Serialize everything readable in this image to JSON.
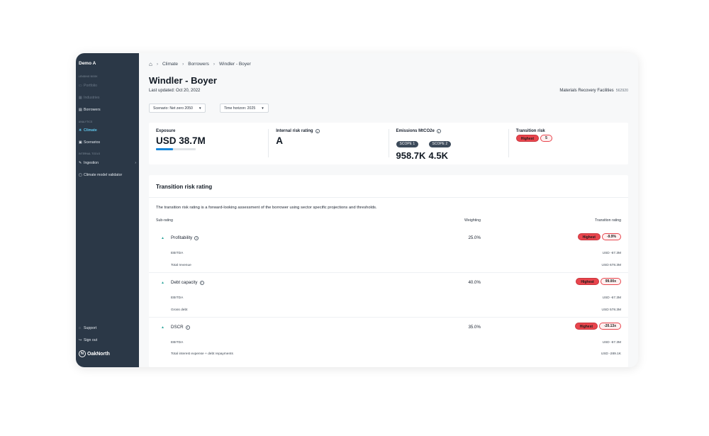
{
  "sidebar": {
    "org": "Demo A",
    "sections": {
      "lending": "LENDING BOOK",
      "analytics": "ANALYTICS",
      "internal": "INTERNAL TOOLS"
    },
    "items": [
      {
        "label": "Portfolio",
        "icon": "portfolio-icon"
      },
      {
        "label": "Industries",
        "icon": "industries-icon"
      },
      {
        "label": "Borrowers",
        "icon": "borrowers-icon"
      },
      {
        "label": "Climate",
        "icon": "climate-icon"
      },
      {
        "label": "Scenarios",
        "icon": "scenarios-icon"
      },
      {
        "label": "Ingestion",
        "icon": "ingestion-icon"
      },
      {
        "label": "Climate model validator",
        "icon": "validator-icon"
      },
      {
        "label": "Support",
        "icon": "support-icon"
      },
      {
        "label": "Sign out",
        "icon": "sign-out-icon"
      }
    ],
    "logo": "OakNorth"
  },
  "breadcrumb": [
    "Climate",
    "Borrowers",
    "Windler - Boyer"
  ],
  "page": {
    "title": "Windler - Boyer",
    "updated": "Last updated: Oct 20, 2022",
    "sector": "Materials Recovery Facilities",
    "sector_code": "562920"
  },
  "filters": {
    "scenario": "Scenario: Net zero 2050",
    "horizon": "Time horizon: 2025"
  },
  "summary": {
    "exposure": {
      "label": "Exposure",
      "value": "USD 38.7M",
      "bar_fill": 0.42
    },
    "internal_rating": {
      "label": "Internal risk rating",
      "value": "A"
    },
    "emissions": {
      "label": "Emissions MtCO2e",
      "scopes": [
        {
          "label": "SCOPE 1",
          "value": "958.7K"
        },
        {
          "label": "SCOPE 2",
          "value": "4.5K"
        }
      ]
    },
    "transition_risk": {
      "label": "Transition risk",
      "level": "Highest",
      "score": "5"
    }
  },
  "panel": {
    "title": "Transition risk rating",
    "description": "The transition risk rating is a forward-looking assessment of the borrower using sector specific projections and thresholds.",
    "col_subrating": "Sub-rating",
    "col_weighting": "Weighting",
    "col_transition": "Transition rating",
    "rows": [
      {
        "name": "Profitability",
        "weight": "25.0%",
        "level": "Highest",
        "score": "-9.9%",
        "subs": [
          {
            "label": "EBITDA",
            "value": "USD -67.3M"
          },
          {
            "label": "Total revenue",
            "value": "USD 678.3M"
          }
        ]
      },
      {
        "name": "Debt capacity",
        "weight": "40.0%",
        "level": "Highest",
        "score": "99.00x",
        "subs": [
          {
            "label": "EBITDA",
            "value": "USD -67.3M"
          },
          {
            "label": "Gross debt",
            "value": "USD 578.3M"
          }
        ]
      },
      {
        "name": "DSCR",
        "weight": "35.0%",
        "level": "Highest",
        "score": "-20.13x",
        "subs": [
          {
            "label": "EBITDA",
            "value": "USD -67.3M"
          },
          {
            "label": "Total interest expense + debt repayments",
            "value": "USD -289.1K"
          }
        ]
      }
    ]
  }
}
